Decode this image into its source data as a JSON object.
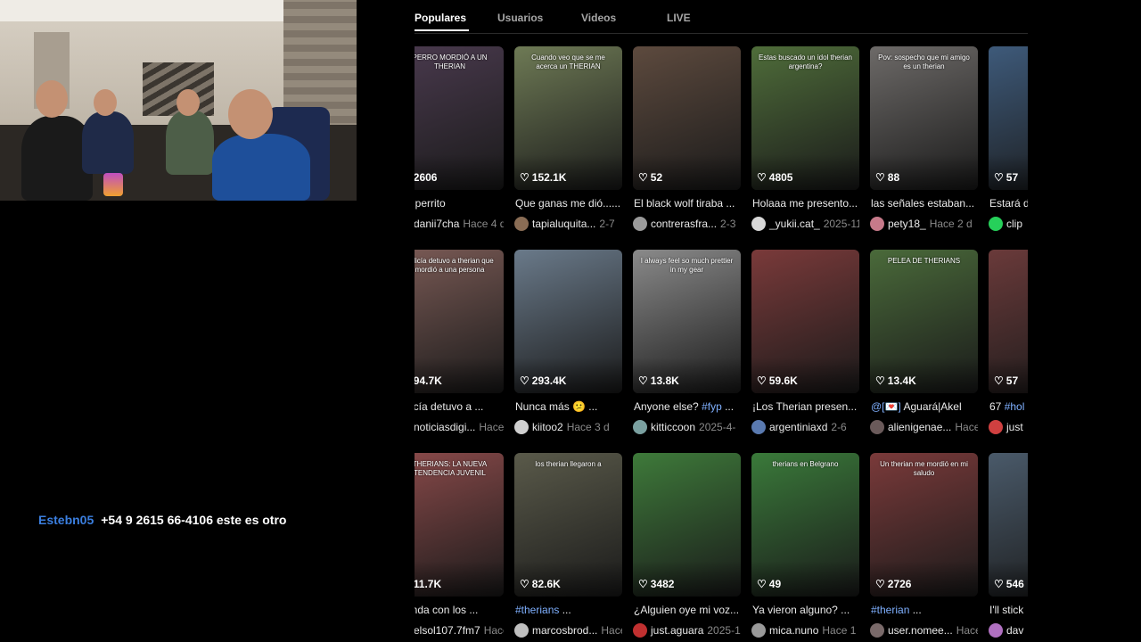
{
  "chat": {
    "user": "Estebn05",
    "message": "+54 9 2615 66-4106 este es otro"
  },
  "tabs": [
    {
      "label": "Populares",
      "active": true
    },
    {
      "label": "Usuarios",
      "active": false
    },
    {
      "label": "Videos",
      "active": false
    },
    {
      "label": "LIVE",
      "active": false
    }
  ],
  "cards": [
    {
      "likes": "2606",
      "desc": "ore perrito",
      "author": "danii7cha",
      "date": "Hace 4 d",
      "overlay": "PERRO MORDIÓ A UN THERIAN",
      "bg": "#4a3a4e",
      "avatar": "#000000"
    },
    {
      "likes": "152.1K",
      "desc": "Que ganas me dió......",
      "author": "tapialuquita...",
      "date": "2-7",
      "overlay": "Cuando veo que se me acerca un THERIAN",
      "bg": "#6e7a55",
      "avatar": "#8a6d55"
    },
    {
      "likes": "52",
      "desc": "El black wolf tiraba ...",
      "author": "contrerasfra...",
      "date": "2-3",
      "overlay": "",
      "bg": "#5d4a3e",
      "avatar": "#9a9a9a"
    },
    {
      "likes": "4805",
      "desc": "Holaaa me presento...",
      "author": "_yukii.cat_",
      "date": "2025-11-",
      "overlay": "Estas buscado un idol therian argentina?",
      "bg": "#4f6d3a",
      "avatar": "#d8d8d8"
    },
    {
      "likes": "88",
      "desc": "las señales estaban...",
      "author": "pety18_",
      "date": "Hace 2 d",
      "overlay": "Pov: sospecho que mi amigo es un therian",
      "bg": "#6d6a68",
      "avatar": "#c77a8a"
    },
    {
      "likes": "57",
      "desc": "Estará d",
      "author": "clip",
      "date": "",
      "overlay": "",
      "bg": "#3e5a7a",
      "avatar": "#26d05a"
    },
    {
      "likes": "94.7K",
      "desc": "policía detuvo a ...",
      "author": "noticiasdigi...",
      "date": "Hace",
      "overlay": "policía detuvo a therian que mordió a una persona",
      "bg": "#7a5a55",
      "avatar": "#e0e0e0"
    },
    {
      "likes": "293.4K",
      "desc": "Nunca más 😕 ...",
      "author": "kiitoo2",
      "date": "Hace 3 d",
      "overlay": "",
      "bg": "#6a7a8a",
      "avatar": "#cfcfcf"
    },
    {
      "likes": "13.8K",
      "desc": "Anyone else? #fyp ...",
      "author": "kitticcoon",
      "date": "2025-4-",
      "overlay": "I always feel so much prettier in my gear",
      "bg": "#8a8a8a",
      "avatar": "#7aa0a0"
    },
    {
      "likes": "59.6K",
      "desc": "¡Los Therian presen...",
      "author": "argentiniaxd",
      "date": "2-6",
      "overlay": "",
      "bg": "#7a3a3a",
      "avatar": "#5a7ab0"
    },
    {
      "likes": "13.4K",
      "desc": "@[💌] Aguará|Akel",
      "author": "alienigenae...",
      "date": "Hace",
      "overlay": "PELEA DE THERIANS",
      "bg": "#4a6a3a",
      "avatar": "#6a5a5a"
    },
    {
      "likes": "57",
      "desc": "67 #hol",
      "author": "just",
      "date": "",
      "overlay": "",
      "bg": "#6a3a3a",
      "avatar": "#d04040"
    },
    {
      "likes": "11.7K",
      "desc": "é onda con los ...",
      "author": "elsol107.7fm7",
      "date": "Hace",
      "overlay": "THERIANS: LA NUEVA TENDENCIA JUVENIL",
      "bg": "#8a4a4a",
      "avatar": "#000000"
    },
    {
      "likes": "82.6K",
      "desc": "#therians ...",
      "author": "marcosbrod...",
      "date": "Hace",
      "overlay": "los therian llegaron a",
      "bg": "#5a5a4a",
      "avatar": "#bfbfbf"
    },
    {
      "likes": "3482",
      "desc": "¿Alguien oye mi voz...",
      "author": "just.aguara",
      "date": "2025-12-",
      "overlay": "",
      "bg": "#3e7a3a",
      "avatar": "#c03030"
    },
    {
      "likes": "49",
      "desc": "Ya vieron alguno? ...",
      "author": "mica.nuno",
      "date": "Hace 1 s",
      "overlay": "therians en Belgrano",
      "bg": "#3a7a3a",
      "avatar": "#9a9a9a"
    },
    {
      "likes": "2726",
      "desc": "#therian ...",
      "author": "user.nomee...",
      "date": "Hace",
      "overlay": "Un therian me mordió en mi saludo",
      "bg": "#7a3a3a",
      "avatar": "#7a6a6a"
    },
    {
      "likes": "546",
      "desc": "I'll stick",
      "author": "dav",
      "date": "",
      "overlay": "But I",
      "bg": "#4a5a6a",
      "avatar": "#b070c0"
    }
  ]
}
